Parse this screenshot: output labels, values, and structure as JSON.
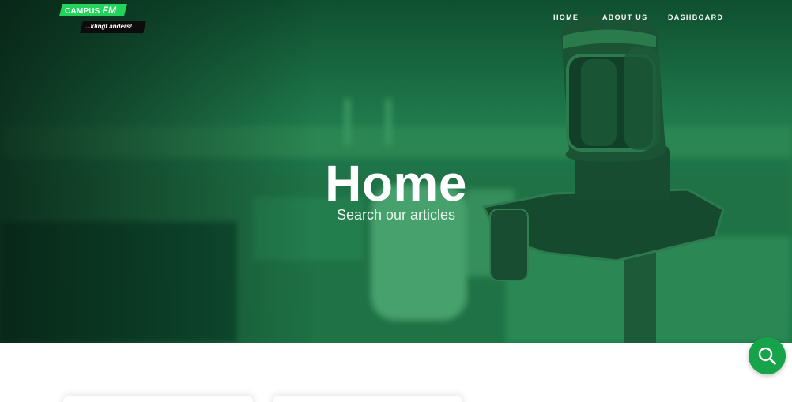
{
  "logo": {
    "brand_text": "CAMPUS",
    "brand_fm": "FM",
    "tagline": "...klingt anders!"
  },
  "nav": {
    "items": [
      {
        "label": "HOME"
      },
      {
        "label": "ABOUT US"
      },
      {
        "label": "DASHBOARD"
      }
    ]
  },
  "hero": {
    "title": "Home",
    "subtitle": "Search our articles"
  },
  "search_fab": {
    "icon": "search-icon"
  },
  "colors": {
    "brand_green": "#23d35c",
    "overlay_green": "#1b7a4b",
    "fab_green": "#16a34a"
  }
}
